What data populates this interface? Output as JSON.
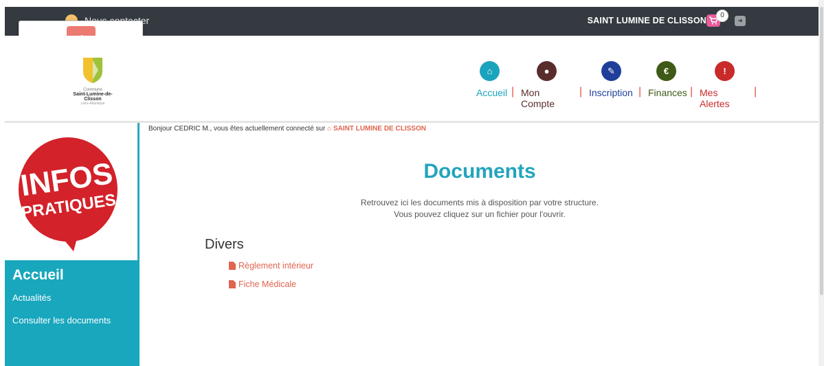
{
  "topbar": {
    "contact_label": "Nous contacter",
    "site_name": "SAINT LUMINE DE CLISSON",
    "cart_count": "0"
  },
  "logo": {
    "line1": "Commune",
    "line2": "Saint-Lumine-de-Clisson",
    "line3": "Loire-Atlantique"
  },
  "nav": {
    "items": [
      {
        "label": "Accueil",
        "color": "#1aa3bd",
        "icon": "home-icon"
      },
      {
        "label": "Mon Compte",
        "color": "#5a2d2d",
        "icon": "user-icon"
      },
      {
        "label": "Inscription",
        "color": "#1f3f9a",
        "icon": "pencil-icon"
      },
      {
        "label": "Finances",
        "color": "#3f5a16",
        "icon": "euro-icon"
      },
      {
        "label": "Mes Alertes",
        "color": "#c92a2a",
        "icon": "warning-icon"
      }
    ]
  },
  "greeting": {
    "text": "Bonjour CEDRIC M., vous êtes actuellement connecté sur",
    "site": "SAINT LUMINE DE CLISSON"
  },
  "main": {
    "title": "Documents",
    "desc_line1": "Retrouvez ici les documents mis à disposition par votre structure.",
    "desc_line2": "Vous pouvez cliquez sur un fichier pour l'ouvrir.",
    "category": "Divers",
    "documents": [
      {
        "label": "Règlement intérieur"
      },
      {
        "label": "Fiche Médicale"
      }
    ]
  },
  "sidebar": {
    "banner_line1": "INFOS",
    "banner_line2": "PRATIQUES",
    "title": "Accueil",
    "links": [
      {
        "label": "Actualités"
      },
      {
        "label": "Consulter les documents"
      }
    ]
  }
}
